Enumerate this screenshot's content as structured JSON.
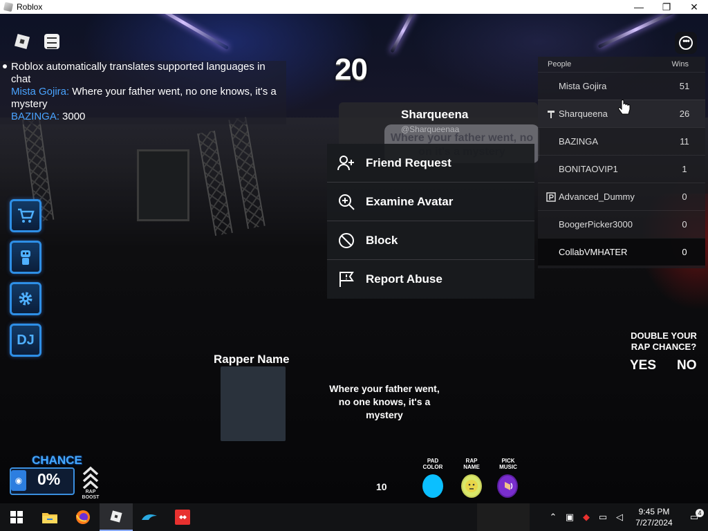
{
  "window": {
    "title": "Roblox",
    "minimize": "—",
    "restore": "❐",
    "close": "✕"
  },
  "top_icons": {
    "roblox_menu": "roblox-icon",
    "chat": "chat-icon",
    "more": "•••"
  },
  "chat": {
    "system": "Roblox automatically translates supported languages in chat",
    "messages": [
      {
        "name": "Mista Gojira:",
        "text": "Where your father went, no one knows, it's a mystery"
      },
      {
        "name": "BAZINGA:",
        "text": "3000"
      }
    ]
  },
  "countdown": "20",
  "player_menu": {
    "display_name": "Sharqueena",
    "handle": "@Sharqueenaa",
    "bubble": "Where your father went, no on  it's a mystery",
    "items": [
      {
        "label": "Friend Request",
        "icon": "add-friend-icon"
      },
      {
        "label": "Examine Avatar",
        "icon": "zoom-icon"
      },
      {
        "label": "Block",
        "icon": "block-icon"
      },
      {
        "label": "Report Abuse",
        "icon": "flag-icon"
      }
    ]
  },
  "leaderboard": {
    "header": {
      "people": "People",
      "wins": "Wins"
    },
    "rows": [
      {
        "name": "Mista Gojira",
        "wins": "51"
      },
      {
        "name": "Sharqueena",
        "wins": "26"
      },
      {
        "name": "BAZINGA",
        "wins": "11"
      },
      {
        "name": "BONITAOVIP1",
        "wins": "1"
      },
      {
        "name": "Advanced_Dummy",
        "wins": "0"
      },
      {
        "name": "BoogerPicker3000",
        "wins": "0"
      },
      {
        "name": "CollabVMHATER",
        "wins": "0"
      }
    ]
  },
  "side_buttons": {
    "shop": "cart-icon",
    "avatar": "robot-icon",
    "settings": "gear-icon",
    "dj": "DJ"
  },
  "rapper": {
    "label": "Rapper Name",
    "lyric": "Where your father went, no one knows, it's a mystery"
  },
  "double_chance": {
    "title": "DOUBLE YOUR RAP CHANCE?",
    "yes": "YES",
    "no": "NO"
  },
  "chance": {
    "label": "CHANCE",
    "value": "0%",
    "boost_label": "RAP BOOST"
  },
  "controls": {
    "count": "10",
    "pad_color": "PAD COLOR",
    "rap_name": "RAP NAME",
    "pick_music": "PICK MUSIC",
    "pad_color_value": "#0bbfff"
  },
  "taskbar": {
    "apps": [
      "windows-start-icon",
      "file-explorer-icon",
      "firefox-icon",
      "roblox-icon",
      "vmware-icon",
      "anydesk-icon"
    ],
    "time": "9:45 PM",
    "date": "7/27/2024",
    "notifications": "4"
  }
}
